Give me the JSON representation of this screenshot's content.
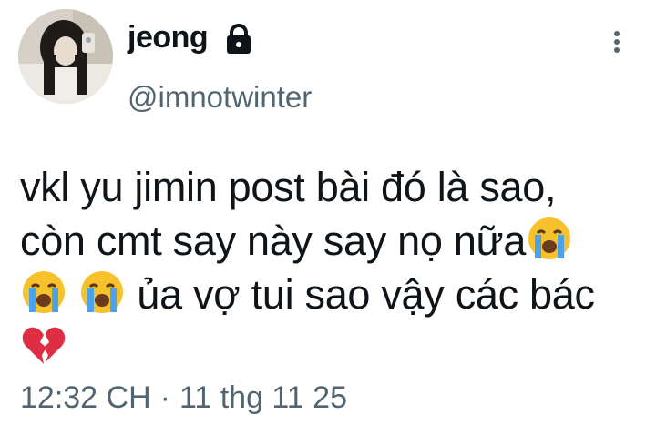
{
  "author": {
    "display_name": "jeong",
    "handle": "@imnotwinter",
    "avatar_icon": "avatar-photo",
    "protected_icon": "lock-icon"
  },
  "tweet": {
    "line1": "vkl yu jimin post bài đó là sao,",
    "line2": "còn cmt say này say nọ nữa",
    "line3": "ủa vợ tui sao vậy các bác",
    "emoji_crying": "loudly-crying-face-emoji",
    "emoji_broken_heart": "broken-heart-emoji"
  },
  "meta": {
    "time": "12:32 CH",
    "separator": "·",
    "date": "11 thg 11 25"
  },
  "more_icon": "more-vertical-icon",
  "colors": {
    "text": "#0f1419",
    "secondary": "#536471",
    "background": "#ffffff"
  }
}
